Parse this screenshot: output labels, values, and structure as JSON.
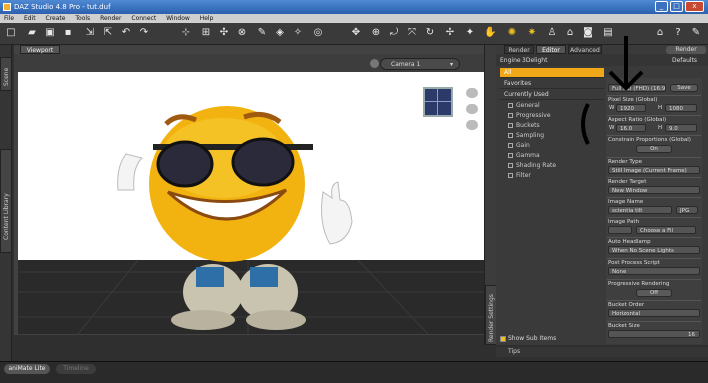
{
  "window": {
    "title": "DAZ Studio 4.8 Pro - tut.duf",
    "min": "_",
    "max": "□",
    "close": "x"
  },
  "menu": [
    "File",
    "Edit",
    "Create",
    "Tools",
    "Render",
    "Connect",
    "Window",
    "Help"
  ],
  "viewport": {
    "tab": "Viewport",
    "camera": "Camera 1"
  },
  "left_tabs": {
    "scene": "Scene",
    "content_library": "Content Library"
  },
  "right_tabs": [
    "Render",
    "Editor",
    "Advanced"
  ],
  "right_strip": {
    "render_settings": "Render Settings"
  },
  "engine_bar": {
    "engine": "Engine",
    "engine_value": "3Delight",
    "render": "Render",
    "defaults": "Defaults"
  },
  "categories": [
    "All",
    "Favorites",
    "Currently Used"
  ],
  "tree": [
    "General",
    "Progressive",
    "Buckets",
    "Sampling",
    "Gain",
    "Gamma",
    "Shading Rate",
    "Filter"
  ],
  "props": {
    "preset": "Full HD (FHD) (16:9)",
    "save": "Save",
    "pixel_size_label": "Pixel Size (Global)",
    "w_label": "W",
    "pixel_w": "1920",
    "h_label": "H",
    "pixel_h": "1080",
    "aspect_label": "Aspect Ratio (Global)",
    "aspect_w": "16.0",
    "aspect_h": "9.0",
    "constrain_label": "Constrain Proportions (Global)",
    "constrain_value": "On",
    "render_type_label": "Render Type",
    "render_type": "Still Image (Current Frame)",
    "render_target_label": "Render Target",
    "render_target": "New Window",
    "image_name_label": "Image Name",
    "image_name": "scientia tilt",
    "image_ext": "JPG",
    "image_path_label": "Image Path",
    "image_path": "Choose a Fil",
    "auto_headlamp_label": "Auto Headlamp",
    "auto_headlamp": "When No Scene Lights",
    "post_process_label": "Post Process Script",
    "post_process": "None",
    "progressive_label": "Progressive Rendering",
    "progressive_value": "Off",
    "bucket_order_label": "Bucket Order",
    "bucket_order": "Horizontal",
    "bucket_size_label": "Bucket Size",
    "bucket_size": "16"
  },
  "show_sub_items": "Show Sub Items",
  "tips": "Tips",
  "bottom_tabs": [
    "aniMate Lite",
    "Timeline"
  ],
  "colors": {
    "accent": "#f0a818"
  }
}
